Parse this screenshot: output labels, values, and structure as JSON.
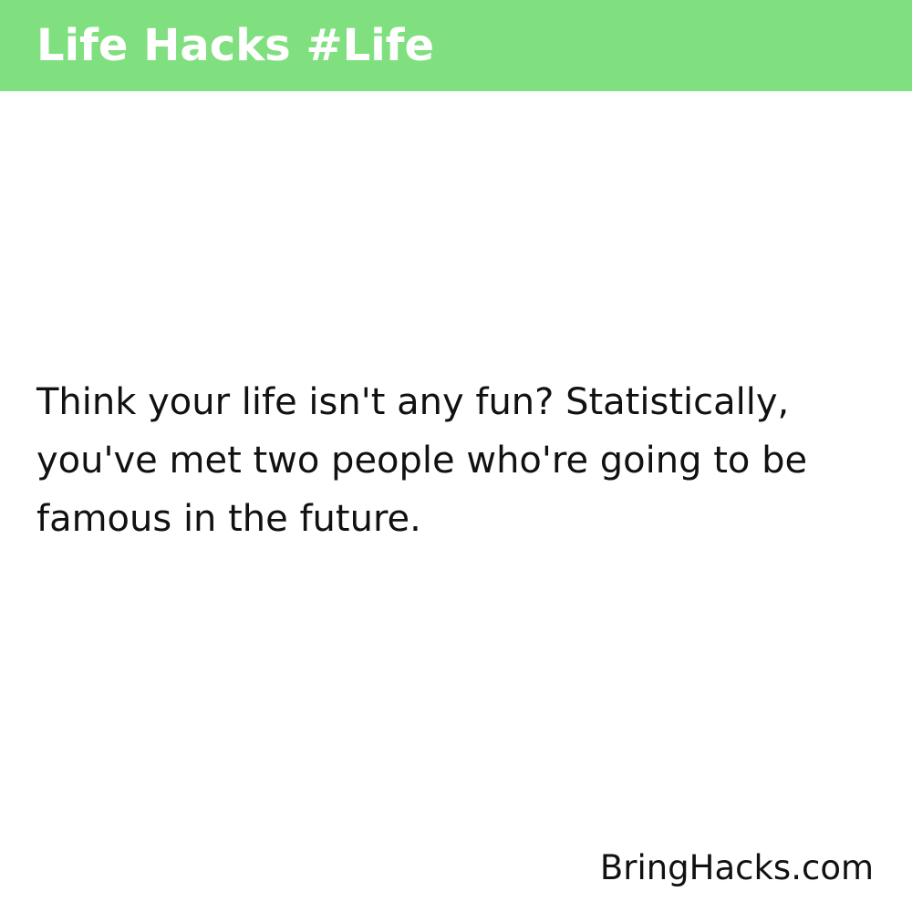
{
  "header": {
    "title": "Life Hacks #Life",
    "background_color": "#80e080",
    "text_color": "#ffffff"
  },
  "main": {
    "hack_text": "Think your life isn't any fun? Statistically, you've met two people who're going to be famous in the future."
  },
  "footer": {
    "site": "BringHacks.com"
  }
}
